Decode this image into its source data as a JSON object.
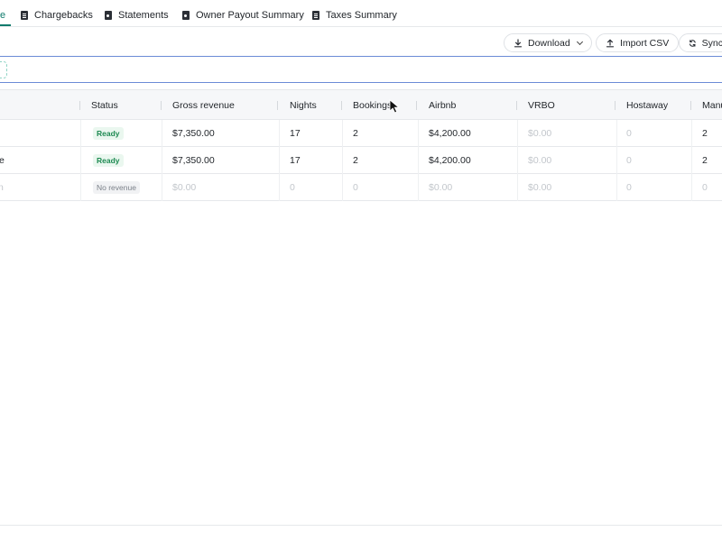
{
  "tabs": [
    {
      "label": "e",
      "icon": "none",
      "active": true
    },
    {
      "label": "Chargebacks",
      "icon": "document-icon"
    },
    {
      "label": "Statements",
      "icon": "statement-icon"
    },
    {
      "label": "Owner Payout Summary",
      "icon": "statement-icon"
    },
    {
      "label": "Taxes Summary",
      "icon": "document-icon"
    }
  ],
  "toolbar": {
    "download_label": "Download",
    "import_label": "Import CSV",
    "sync_label": "Sync"
  },
  "table": {
    "columns": [
      "Status",
      "Gross revenue",
      "Nights",
      "Bookings",
      "Airbnb",
      "VRBO",
      "Hostaway",
      "Manu"
    ],
    "rows": [
      {
        "name": "",
        "status": "Ready",
        "gross": "$7,350.00",
        "nights": "17",
        "bookings": "2",
        "airbnb": "$4,200.00",
        "vrbo": "$0.00",
        "hostaway": "0",
        "manual": "2"
      },
      {
        "name": "e",
        "status": "Ready",
        "gross": "$7,350.00",
        "nights": "17",
        "bookings": "2",
        "airbnb": "$4,200.00",
        "vrbo": "$0.00",
        "hostaway": "0",
        "manual": "2"
      },
      {
        "name": "n",
        "status": "No revenue",
        "gross": "$0.00",
        "nights": "0",
        "bookings": "0",
        "airbnb": "$0.00",
        "vrbo": "$0.00",
        "hostaway": "0",
        "manual": "0"
      }
    ]
  },
  "colors": {
    "accent": "#0f7b6c",
    "ready": "#1e8a52",
    "focus_border": "#6b8bd6"
  }
}
